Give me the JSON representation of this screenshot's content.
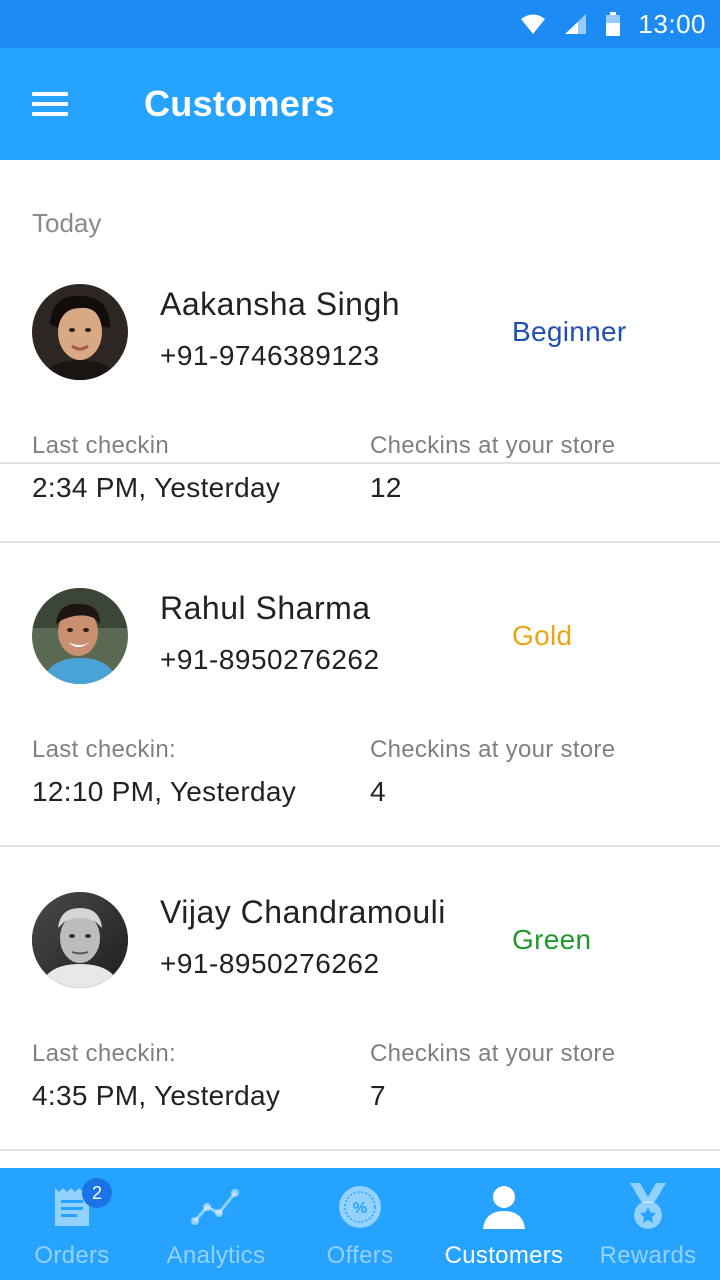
{
  "status_bar": {
    "time": "13:00"
  },
  "app_bar": {
    "title": "Customers"
  },
  "section": {
    "label": "Today"
  },
  "customers": [
    {
      "name": "Aakansha Singh",
      "phone": "+91-9746389123",
      "tier": "Beginner",
      "tier_color": "#1f4fb0",
      "last_checkin_label": "Last checkin",
      "last_checkin": "2:34 PM, Yesterday",
      "checkins_label": "Checkins at your store",
      "checkins": "12"
    },
    {
      "name": "Rahul Sharma",
      "phone": "+91-8950276262",
      "tier": "Gold",
      "tier_color": "#e8a712",
      "last_checkin_label": "Last checkin:",
      "last_checkin": "12:10 PM, Yesterday",
      "checkins_label": "Checkins at your store",
      "checkins": "4"
    },
    {
      "name": "Vijay Chandramouli",
      "phone": "+91-8950276262",
      "tier": "Green",
      "tier_color": "#1f9a2a",
      "last_checkin_label": "Last checkin:",
      "last_checkin": "4:35 PM, Yesterday",
      "checkins_label": "Checkins at your store",
      "checkins": "7"
    }
  ],
  "bottom_nav": {
    "items": [
      {
        "label": "Orders",
        "icon": "receipt-icon",
        "badge": "2"
      },
      {
        "label": "Analytics",
        "icon": "analytics-icon"
      },
      {
        "label": "Offers",
        "icon": "offer-percent-icon"
      },
      {
        "label": "Customers",
        "icon": "person-icon",
        "active": true
      },
      {
        "label": "Rewards",
        "icon": "medal-icon"
      }
    ]
  },
  "colors": {
    "app_bar": "#26a2ff",
    "status_bar": "#1c8cf4",
    "active_nav": "#ffffff",
    "inactive_nav": "#8fd0ff"
  }
}
